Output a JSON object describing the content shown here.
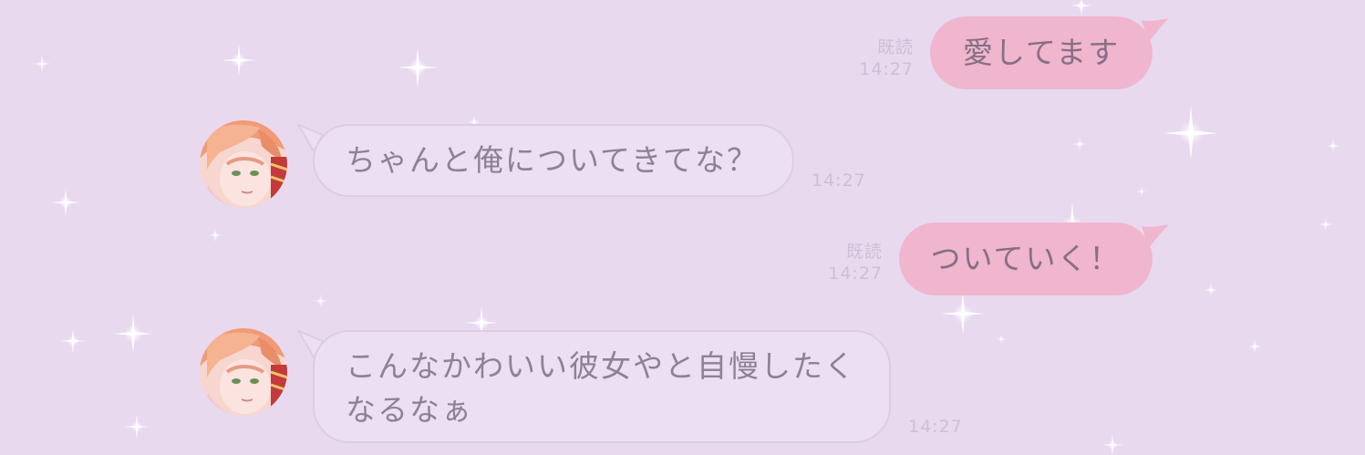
{
  "theme": {
    "background": "#e8d9ef",
    "sent_bubble": "#efb6cd",
    "received_bubble": "#ecdff1",
    "received_border": "#dccde5",
    "text": "#8e8196",
    "meta_text": "#cdbfd5",
    "sparkle": "#ffffff"
  },
  "messages": [
    {
      "direction": "sent",
      "text": "愛してます",
      "read_label": "既読",
      "time": "14:27"
    },
    {
      "direction": "received",
      "avatar": "character-avatar-icon",
      "text": "ちゃんと俺についてきてな？",
      "time": "14:27"
    },
    {
      "direction": "sent",
      "text": "ついていく！",
      "read_label": "既読",
      "time": "14:27"
    },
    {
      "direction": "received",
      "avatar": "character-avatar-icon",
      "text_lines": [
        "こんなかわいい彼女やと自慢したく",
        "なるなぁ"
      ],
      "time": "14:27"
    }
  ]
}
